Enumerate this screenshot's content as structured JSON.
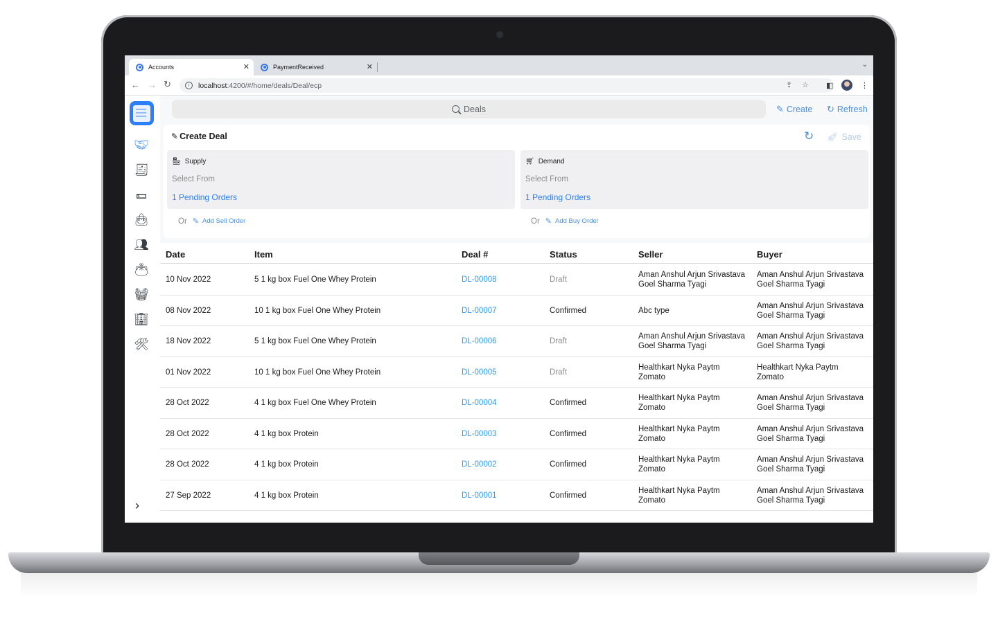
{
  "browser": {
    "tabs": [
      {
        "title": "Accounts",
        "active": true
      },
      {
        "title": "PaymentReceived",
        "active": false
      }
    ],
    "url_host": "localhost",
    "url_path": ":4200/#/home/deals/Deal/ecp"
  },
  "header": {
    "search_placeholder": "Deals",
    "create_label": "Create",
    "refresh_label": "Refresh"
  },
  "create_deal": {
    "title": "Create Deal",
    "save_label": "Save",
    "supply": {
      "title": "Supply",
      "select_from": "Select From",
      "pending_link": "1 Pending Orders",
      "or_label": "Or",
      "add_label": "Add Sell Order"
    },
    "demand": {
      "title": "Demand",
      "select_from": "Select From",
      "pending_link": "1 Pending Orders",
      "or_label": "Or",
      "add_label": "Add Buy Order"
    }
  },
  "table": {
    "columns": [
      "Date",
      "Item",
      "Deal #",
      "Status",
      "Seller",
      "Buyer"
    ],
    "rows": [
      {
        "date": "10 Nov 2022",
        "item": "5 1 kg box Fuel One Whey Protein",
        "deal": "DL-00008",
        "status": "Draft",
        "seller1": "Aman Anshul Arjun Srivastava",
        "seller2": "Goel Sharma Tyagi",
        "buyer1": "Aman Anshul Arjun Srivastava",
        "buyer2": "Goel Sharma Tyagi"
      },
      {
        "date": "08 Nov 2022",
        "item": "10 1 kg box Fuel One Whey Protein",
        "deal": "DL-00007",
        "status": "Confirmed",
        "seller1": "Abc type",
        "seller2": "",
        "buyer1": "Aman Anshul Arjun Srivastava",
        "buyer2": "Goel Sharma Tyagi"
      },
      {
        "date": "18 Nov 2022",
        "item": "5 1 kg box Fuel One Whey Protein",
        "deal": "DL-00006",
        "status": "Draft",
        "seller1": "Aman Anshul Arjun Srivastava",
        "seller2": "Goel Sharma Tyagi",
        "buyer1": "Aman Anshul Arjun Srivastava",
        "buyer2": "Goel Sharma Tyagi"
      },
      {
        "date": "01 Nov 2022",
        "item": "10 1 kg box Fuel One Whey Protein",
        "deal": "DL-00005",
        "status": "Draft",
        "seller1": "Healthkart Nyka Paytm",
        "seller2": "Zomato",
        "buyer1": "Healthkart Nyka Paytm",
        "buyer2": "Zomato"
      },
      {
        "date": "28 Oct 2022",
        "item": "4 1 kg box Fuel One Whey Protein",
        "deal": "DL-00004",
        "status": "Confirmed",
        "seller1": "Healthkart Nyka Paytm",
        "seller2": "Zomato",
        "buyer1": "Aman Anshul Arjun Srivastava",
        "buyer2": "Goel Sharma Tyagi"
      },
      {
        "date": "28 Oct 2022",
        "item": "4 1 kg box Protein",
        "deal": "DL-00003",
        "status": "Confirmed",
        "seller1": "Healthkart Nyka Paytm",
        "seller2": "Zomato",
        "buyer1": "Aman Anshul Arjun Srivastava",
        "buyer2": "Goel Sharma Tyagi"
      },
      {
        "date": "28 Oct 2022",
        "item": "4 1 kg box Protein",
        "deal": "DL-00002",
        "status": "Confirmed",
        "seller1": "Healthkart Nyka Paytm",
        "seller2": "Zomato",
        "buyer1": "Aman Anshul Arjun Srivastava",
        "buyer2": "Goel Sharma Tyagi"
      },
      {
        "date": "27 Sep 2022",
        "item": "4 1 kg box Protein",
        "deal": "DL-00001",
        "status": "Confirmed",
        "seller1": "Healthkart Nyka Paytm",
        "seller2": "Zomato",
        "buyer1": "Aman Anshul Arjun Srivastava",
        "buyer2": "Goel Sharma Tyagi"
      }
    ]
  },
  "sidebar": {
    "icons": [
      "handshake-icon",
      "receipt-icon",
      "cash-icon",
      "shopping-bag-icon",
      "users-icon",
      "wallet-icon",
      "basket-icon",
      "building-icon",
      "tools-icon"
    ]
  },
  "colors": {
    "accent": "#2d7ff9",
    "link": "#2d9bf0",
    "draft": "#8c8c8c"
  }
}
